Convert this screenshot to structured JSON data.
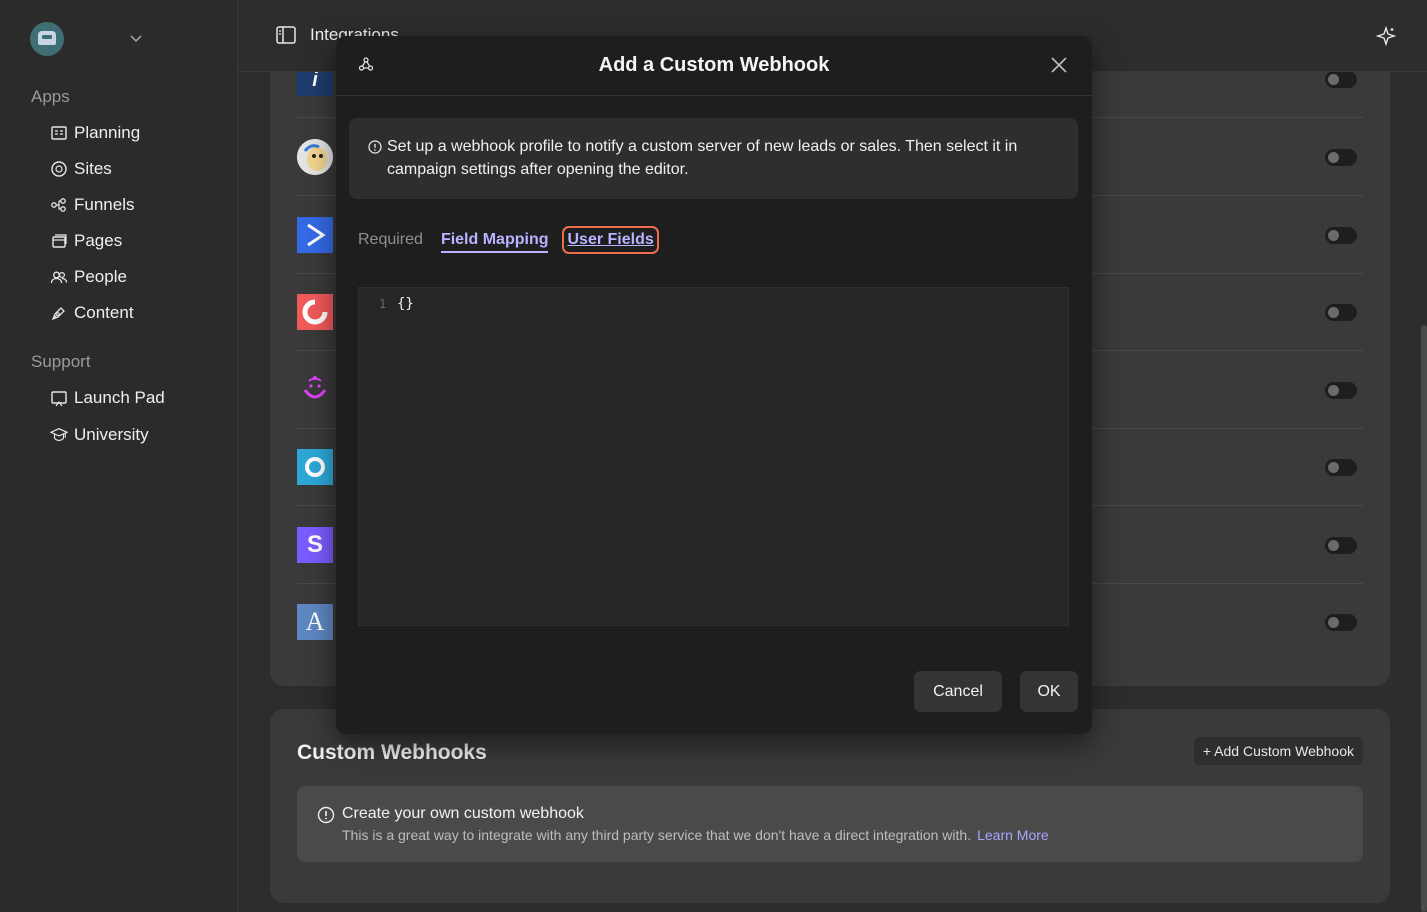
{
  "sidebar": {
    "apps_label": "Apps",
    "apps": [
      {
        "label": "Planning",
        "icon": "planning-icon"
      },
      {
        "label": "Sites",
        "icon": "sites-icon"
      },
      {
        "label": "Funnels",
        "icon": "funnels-icon"
      },
      {
        "label": "Pages",
        "icon": "pages-icon"
      },
      {
        "label": "People",
        "icon": "people-icon"
      },
      {
        "label": "Content",
        "icon": "content-icon"
      }
    ],
    "support_label": "Support",
    "support": [
      {
        "label": "Launch Pad",
        "icon": "launch-pad-icon"
      },
      {
        "label": "University",
        "icon": "university-icon"
      }
    ]
  },
  "topbar": {
    "title": "Integrations"
  },
  "integrations": [
    {
      "name": "integration-1",
      "color": "#2c4a7a",
      "enabled": false
    },
    {
      "name": "mailchimp",
      "color": "#f6d58a",
      "enabled": false
    },
    {
      "name": "activecampaign",
      "color": "#356ae6",
      "enabled": false
    },
    {
      "name": "constant-contact",
      "color": "#f25a5a",
      "enabled": false
    },
    {
      "name": "drip",
      "color": "#e040fb",
      "enabled": false
    },
    {
      "name": "ontraport",
      "color": "#2ea8d8",
      "enabled": false
    },
    {
      "name": "sendlane",
      "color": "#7b5cff",
      "enabled": false
    },
    {
      "name": "aweber",
      "color": "#5f88c2",
      "enabled": false
    }
  ],
  "webhooks": {
    "heading": "Custom Webhooks",
    "add_button": "+ Add Custom Webhook",
    "notice_title": "Create your own custom webhook",
    "notice_desc": "This is a great way to integrate with any third party service that we don't have a direct integration with.",
    "notice_link": "Learn More"
  },
  "modal": {
    "title": "Add a Custom Webhook",
    "info": "Set up a webhook profile to notify a custom server of new leads or sales. Then select it in campaign settings after opening the editor.",
    "tabs": {
      "required": "Required",
      "field_mapping": "Field Mapping",
      "user_fields": "User Fields"
    },
    "editor": {
      "line_number": "1",
      "code": "{}"
    },
    "cancel_label": "Cancel",
    "ok_label": "OK"
  }
}
